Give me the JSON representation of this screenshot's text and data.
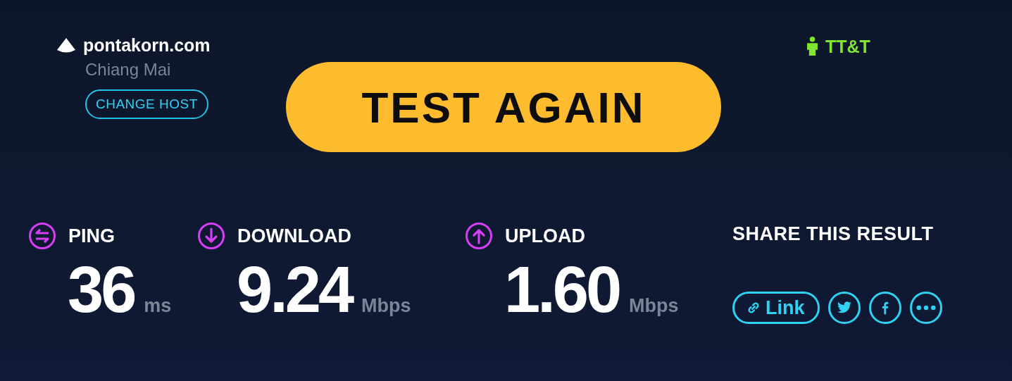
{
  "host": {
    "name": "pontakorn.com",
    "location": "Chiang Mai",
    "change_button": "CHANGE HOST"
  },
  "test_button": "TEST AGAIN",
  "isp": {
    "name": "TT&T"
  },
  "metrics": [
    {
      "kind": "ping",
      "label": "PING",
      "value": "36",
      "unit": "ms"
    },
    {
      "kind": "download",
      "label": "DOWNLOAD",
      "value": "9.24",
      "unit": "Mbps"
    },
    {
      "kind": "upload",
      "label": "UPLOAD",
      "value": "1.60",
      "unit": "Mbps"
    }
  ],
  "share": {
    "title": "SHARE THIS RESULT",
    "link_button": "Link",
    "buttons": [
      {
        "kind": "twitter"
      },
      {
        "kind": "facebook"
      },
      {
        "kind": "more"
      }
    ]
  }
}
